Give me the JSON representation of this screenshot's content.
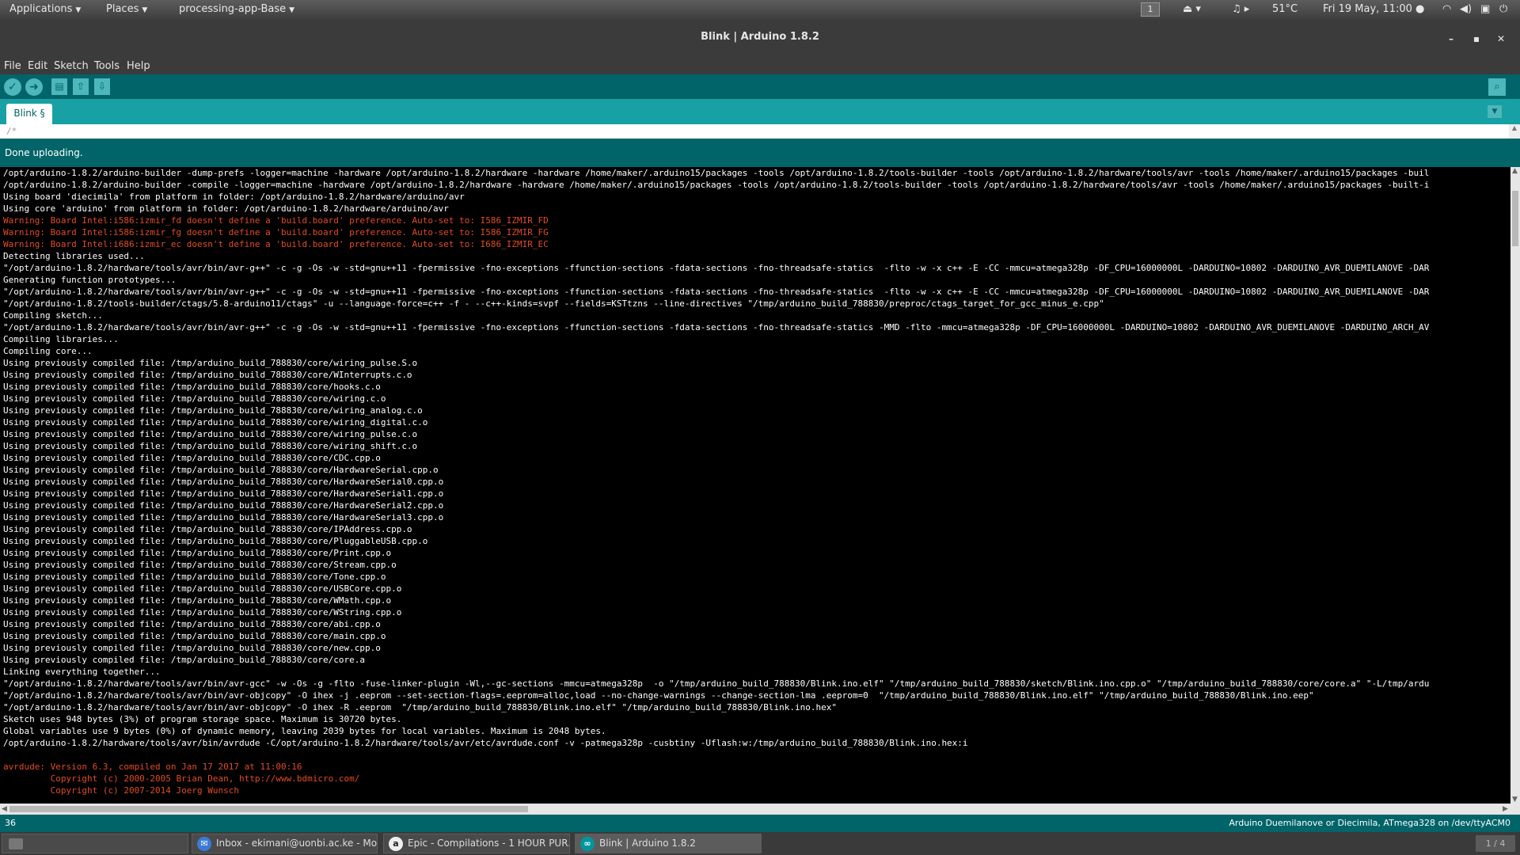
{
  "colors": {
    "teal_dark": "#006468",
    "teal": "#17a1a5",
    "teal_light": "#4db7bb",
    "warning_text": "#e34c22"
  },
  "top_panel": {
    "applications": "Applications",
    "places": "Places",
    "active_app": "processing-app-Base",
    "workspace": "1",
    "temperature": "51°C",
    "clock": "Fri 19 May, 11:00 ●",
    "icons": [
      "eject-icon",
      "music-icon",
      "wifi-icon",
      "volume-icon",
      "lock-icon",
      "power-icon"
    ]
  },
  "window": {
    "title": "Blink | Arduino 1.8.2",
    "minimize": "–",
    "maximize": "▪",
    "close": "✕"
  },
  "menubar": {
    "items": [
      "File",
      "Edit",
      "Sketch",
      "Tools",
      "Help"
    ]
  },
  "toolbar": {
    "verify": "✓",
    "upload": "➜",
    "new": "▤",
    "open": "⇧",
    "save": "⇩",
    "serial_monitor": "⌕"
  },
  "tabs": {
    "sketch_tab": "Blink §",
    "tab_menu": "▼"
  },
  "editor": {
    "first_line": "/*"
  },
  "status": {
    "message": "Done uploading."
  },
  "console": {
    "lines": [
      {
        "text": "/opt/arduino-1.8.2/arduino-builder -dump-prefs -logger=machine -hardware /opt/arduino-1.8.2/hardware -hardware /home/maker/.arduino15/packages -tools /opt/arduino-1.8.2/tools-builder -tools /opt/arduino-1.8.2/hardware/tools/avr -tools /home/maker/.arduino15/packages -buil",
        "warn": false
      },
      {
        "text": "/opt/arduino-1.8.2/arduino-builder -compile -logger=machine -hardware /opt/arduino-1.8.2/hardware -hardware /home/maker/.arduino15/packages -tools /opt/arduino-1.8.2/tools-builder -tools /opt/arduino-1.8.2/hardware/tools/avr -tools /home/maker/.arduino15/packages -built-i",
        "warn": false
      },
      {
        "text": "Using board 'diecimila' from platform in folder: /opt/arduino-1.8.2/hardware/arduino/avr",
        "warn": false
      },
      {
        "text": "Using core 'arduino' from platform in folder: /opt/arduino-1.8.2/hardware/arduino/avr",
        "warn": false
      },
      {
        "text": "Warning: Board Intel:i586:izmir_fd doesn't define a 'build.board' preference. Auto-set to: I586_IZMIR_FD",
        "warn": true
      },
      {
        "text": "Warning: Board Intel:i586:izmir_fg doesn't define a 'build.board' preference. Auto-set to: I586_IZMIR_FG",
        "warn": true
      },
      {
        "text": "Warning: Board Intel:i686:izmir_ec doesn't define a 'build.board' preference. Auto-set to: I686_IZMIR_EC",
        "warn": true
      },
      {
        "text": "Detecting libraries used...",
        "warn": false
      },
      {
        "text": "\"/opt/arduino-1.8.2/hardware/tools/avr/bin/avr-g++\" -c -g -Os -w -std=gnu++11 -fpermissive -fno-exceptions -ffunction-sections -fdata-sections -fno-threadsafe-statics  -flto -w -x c++ -E -CC -mmcu=atmega328p -DF_CPU=16000000L -DARDUINO=10802 -DARDUINO_AVR_DUEMILANOVE -DAR",
        "warn": false
      },
      {
        "text": "Generating function prototypes...",
        "warn": false
      },
      {
        "text": "\"/opt/arduino-1.8.2/hardware/tools/avr/bin/avr-g++\" -c -g -Os -w -std=gnu++11 -fpermissive -fno-exceptions -ffunction-sections -fdata-sections -fno-threadsafe-statics  -flto -w -x c++ -E -CC -mmcu=atmega328p -DF_CPU=16000000L -DARDUINO=10802 -DARDUINO_AVR_DUEMILANOVE -DAR",
        "warn": false
      },
      {
        "text": "\"/opt/arduino-1.8.2/tools-builder/ctags/5.8-arduino11/ctags\" -u --language-force=c++ -f - --c++-kinds=svpf --fields=KSTtzns --line-directives \"/tmp/arduino_build_788830/preproc/ctags_target_for_gcc_minus_e.cpp\"",
        "warn": false
      },
      {
        "text": "Compiling sketch...",
        "warn": false
      },
      {
        "text": "\"/opt/arduino-1.8.2/hardware/tools/avr/bin/avr-g++\" -c -g -Os -w -std=gnu++11 -fpermissive -fno-exceptions -ffunction-sections -fdata-sections -fno-threadsafe-statics -MMD -flto -mmcu=atmega328p -DF_CPU=16000000L -DARDUINO=10802 -DARDUINO_AVR_DUEMILANOVE -DARDUINO_ARCH_AV",
        "warn": false
      },
      {
        "text": "Compiling libraries...",
        "warn": false
      },
      {
        "text": "Compiling core...",
        "warn": false
      },
      {
        "text": "Using previously compiled file: /tmp/arduino_build_788830/core/wiring_pulse.S.o",
        "warn": false
      },
      {
        "text": "Using previously compiled file: /tmp/arduino_build_788830/core/WInterrupts.c.o",
        "warn": false
      },
      {
        "text": "Using previously compiled file: /tmp/arduino_build_788830/core/hooks.c.o",
        "warn": false
      },
      {
        "text": "Using previously compiled file: /tmp/arduino_build_788830/core/wiring.c.o",
        "warn": false
      },
      {
        "text": "Using previously compiled file: /tmp/arduino_build_788830/core/wiring_analog.c.o",
        "warn": false
      },
      {
        "text": "Using previously compiled file: /tmp/arduino_build_788830/core/wiring_digital.c.o",
        "warn": false
      },
      {
        "text": "Using previously compiled file: /tmp/arduino_build_788830/core/wiring_pulse.c.o",
        "warn": false
      },
      {
        "text": "Using previously compiled file: /tmp/arduino_build_788830/core/wiring_shift.c.o",
        "warn": false
      },
      {
        "text": "Using previously compiled file: /tmp/arduino_build_788830/core/CDC.cpp.o",
        "warn": false
      },
      {
        "text": "Using previously compiled file: /tmp/arduino_build_788830/core/HardwareSerial.cpp.o",
        "warn": false
      },
      {
        "text": "Using previously compiled file: /tmp/arduino_build_788830/core/HardwareSerial0.cpp.o",
        "warn": false
      },
      {
        "text": "Using previously compiled file: /tmp/arduino_build_788830/core/HardwareSerial1.cpp.o",
        "warn": false
      },
      {
        "text": "Using previously compiled file: /tmp/arduino_build_788830/core/HardwareSerial2.cpp.o",
        "warn": false
      },
      {
        "text": "Using previously compiled file: /tmp/arduino_build_788830/core/HardwareSerial3.cpp.o",
        "warn": false
      },
      {
        "text": "Using previously compiled file: /tmp/arduino_build_788830/core/IPAddress.cpp.o",
        "warn": false
      },
      {
        "text": "Using previously compiled file: /tmp/arduino_build_788830/core/PluggableUSB.cpp.o",
        "warn": false
      },
      {
        "text": "Using previously compiled file: /tmp/arduino_build_788830/core/Print.cpp.o",
        "warn": false
      },
      {
        "text": "Using previously compiled file: /tmp/arduino_build_788830/core/Stream.cpp.o",
        "warn": false
      },
      {
        "text": "Using previously compiled file: /tmp/arduino_build_788830/core/Tone.cpp.o",
        "warn": false
      },
      {
        "text": "Using previously compiled file: /tmp/arduino_build_788830/core/USBCore.cpp.o",
        "warn": false
      },
      {
        "text": "Using previously compiled file: /tmp/arduino_build_788830/core/WMath.cpp.o",
        "warn": false
      },
      {
        "text": "Using previously compiled file: /tmp/arduino_build_788830/core/WString.cpp.o",
        "warn": false
      },
      {
        "text": "Using previously compiled file: /tmp/arduino_build_788830/core/abi.cpp.o",
        "warn": false
      },
      {
        "text": "Using previously compiled file: /tmp/arduino_build_788830/core/main.cpp.o",
        "warn": false
      },
      {
        "text": "Using previously compiled file: /tmp/arduino_build_788830/core/new.cpp.o",
        "warn": false
      },
      {
        "text": "Using previously compiled file: /tmp/arduino_build_788830/core/core.a",
        "warn": false
      },
      {
        "text": "Linking everything together...",
        "warn": false
      },
      {
        "text": "\"/opt/arduino-1.8.2/hardware/tools/avr/bin/avr-gcc\" -w -Os -g -flto -fuse-linker-plugin -Wl,--gc-sections -mmcu=atmega328p  -o \"/tmp/arduino_build_788830/Blink.ino.elf\" \"/tmp/arduino_build_788830/sketch/Blink.ino.cpp.o\" \"/tmp/arduino_build_788830/core/core.a\" \"-L/tmp/ardu",
        "warn": false
      },
      {
        "text": "\"/opt/arduino-1.8.2/hardware/tools/avr/bin/avr-objcopy\" -O ihex -j .eeprom --set-section-flags=.eeprom=alloc,load --no-change-warnings --change-section-lma .eeprom=0  \"/tmp/arduino_build_788830/Blink.ino.elf\" \"/tmp/arduino_build_788830/Blink.ino.eep\"",
        "warn": false
      },
      {
        "text": "\"/opt/arduino-1.8.2/hardware/tools/avr/bin/avr-objcopy\" -O ihex -R .eeprom  \"/tmp/arduino_build_788830/Blink.ino.elf\" \"/tmp/arduino_build_788830/Blink.ino.hex\"",
        "warn": false
      },
      {
        "text": "Sketch uses 948 bytes (3%) of program storage space. Maximum is 30720 bytes.",
        "warn": false
      },
      {
        "text": "Global variables use 9 bytes (0%) of dynamic memory, leaving 2039 bytes for local variables. Maximum is 2048 bytes.",
        "warn": false
      },
      {
        "text": "/opt/arduino-1.8.2/hardware/tools/avr/bin/avrdude -C/opt/arduino-1.8.2/hardware/tools/avr/etc/avrdude.conf -v -patmega328p -cusbtiny -Uflash:w:/tmp/arduino_build_788830/Blink.ino.hex:i",
        "warn": false
      },
      {
        "text": "",
        "warn": false
      },
      {
        "text": "avrdude: Version 6.3, compiled on Jan 17 2017 at 11:00:16",
        "warn": true
      },
      {
        "text": "         Copyright (c) 2000-2005 Brian Dean, http://www.bdmicro.com/",
        "warn": true
      },
      {
        "text": "         Copyright (c) 2007-2014 Joerg Wunsch",
        "warn": true
      }
    ]
  },
  "bottom_status": {
    "line_number": "36",
    "board": "Arduino Duemilanove or Diecimila, ATmega328 on /dev/ttyACM0"
  },
  "taskbar": {
    "tasks": [
      {
        "label": "",
        "icon": "desktop-icon"
      },
      {
        "label": "Inbox - ekimani@uonbi.ac.ke - Mo...",
        "icon": "thunderbird-icon"
      },
      {
        "label": "Epic - Compilations - 1 HOUR PUR...",
        "icon": "obs-icon"
      },
      {
        "label": "Blink | Arduino 1.8.2",
        "icon": "arduino-icon"
      }
    ],
    "pager": "1 / 4"
  }
}
